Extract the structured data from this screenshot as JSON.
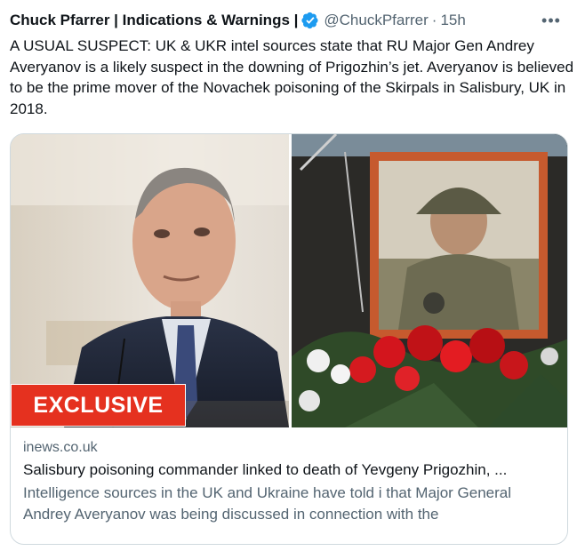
{
  "tweet": {
    "author_name": "Chuck Pfarrer | Indications & Warnings |",
    "handle": "@ChuckPfarrer",
    "separator": "·",
    "time": "15h",
    "more_glyph": "•••",
    "text": "A USUAL SUSPECT: UK & UKR intel sources state that RU Major Gen Andrey Averyanov is a likely suspect in the downing of Prigozhin’s jet.  Averyanov is believed to be the prime mover of the Novachek poisoning of the Skirpals in Salisbury, UK in 2018."
  },
  "card": {
    "badge_label": "EXCLUSIVE",
    "domain": "inews.co.uk",
    "title": "Salisbury poisoning commander linked to death of Yevgeny Prigozhin, ...",
    "description": "Intelligence sources in the UK and Ukraine have told i that Major General Andrey Averyanov was being discussed in connection with the"
  },
  "colors": {
    "verified": "#1d9bf0",
    "badge": "#e5311f",
    "secondary_text": "#536471",
    "border": "#cfd9de"
  },
  "icons": {
    "verified": "verified-badge-icon",
    "more": "more-options-icon"
  }
}
